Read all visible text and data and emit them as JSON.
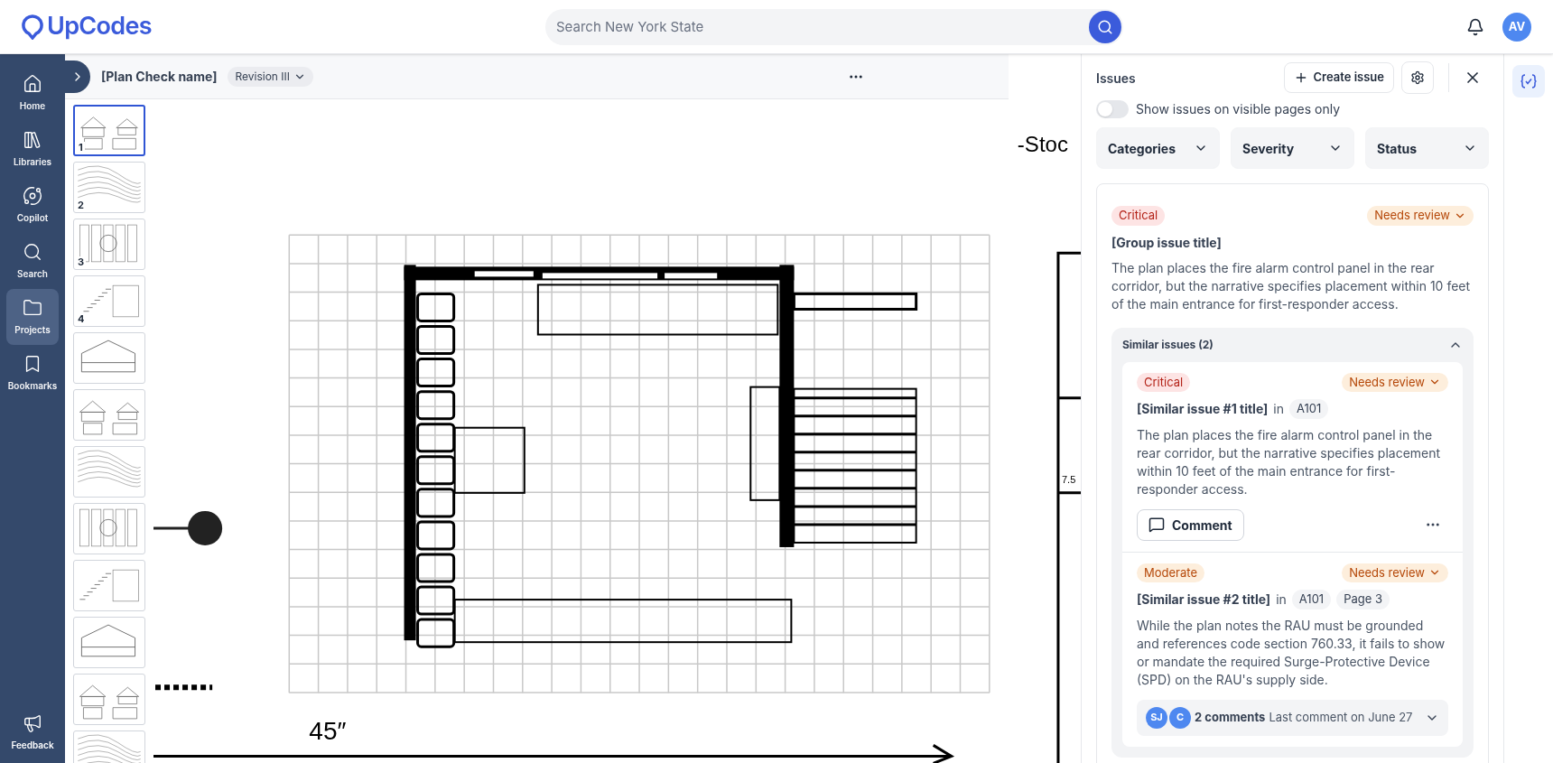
{
  "brand": {
    "name": "UpCodes"
  },
  "search": {
    "placeholder": "Search New York State"
  },
  "user": {
    "initials": "AV"
  },
  "nav": [
    {
      "kind": "home",
      "label": "Home",
      "selected": false
    },
    {
      "kind": "libraries",
      "label": "Libraries",
      "selected": false
    },
    {
      "kind": "copilot",
      "label": "Copilot",
      "selected": false
    },
    {
      "kind": "search",
      "label": "Search",
      "selected": false
    },
    {
      "kind": "projects",
      "label": "Projects",
      "selected": true
    },
    {
      "kind": "bookmarks",
      "label": "Bookmarks",
      "selected": false
    }
  ],
  "nav_footer": {
    "label": "Feedback"
  },
  "viewer": {
    "title": "[Plan Check name]",
    "revision": "Revision III"
  },
  "thumbnails": [
    {
      "label": "1",
      "selected": true
    },
    {
      "label": "2",
      "selected": false
    },
    {
      "label": "3",
      "selected": false
    },
    {
      "label": "4",
      "selected": false
    },
    {
      "selected": false
    },
    {
      "selected": false
    },
    {
      "selected": false
    },
    {
      "selected": false
    },
    {
      "selected": false
    },
    {
      "selected": false
    },
    {
      "selected": false
    },
    {
      "selected": false
    }
  ],
  "plan": {
    "labels": [
      "-Stoc",
      "45″",
      "7.5"
    ]
  },
  "issues": {
    "title": "Issues",
    "create_label": "Create issue",
    "toggle": {
      "label": "Show issues on visible pages only",
      "on": false
    },
    "filters": [
      "Categories",
      "Severity",
      "Status"
    ],
    "group": {
      "severity": {
        "kind": "critical",
        "label": "Critical"
      },
      "status": "Needs review",
      "title": "[Group issue title]",
      "body": "The plan places the fire alarm control panel in the rear corridor, but the narrative specifies placement within 10 feet of the main entrance for first-responder access.",
      "similar": {
        "label": "Similar issues (2)",
        "expanded": true,
        "items": [
          {
            "severity": {
              "kind": "critical",
              "label": "Critical"
            },
            "status": "Needs review",
            "title": "[Similar issue #1 title]",
            "in": "in",
            "tags": [
              "A101"
            ],
            "body": "The plan places the fire alarm control panel in the rear corridor, but the narrative specifies placement within 10 feet of the main entrance for first-responder access.",
            "footer": {
              "kind": "comment",
              "label": "Comment"
            }
          },
          {
            "severity": {
              "kind": "moderate",
              "label": "Moderate"
            },
            "status": "Needs review",
            "title": "[Similar issue #2 title]",
            "in": "in",
            "tags": [
              "A101",
              "Page 3"
            ],
            "body": "While the plan notes the RAU must be grounded and references code section 760.33, it fails to show or mandate the required Surge-Protective Device (SPD) on the RAU's supply side.",
            "footer": {
              "kind": "thread",
              "avatars": [
                "SJ",
                "C"
              ],
              "count": "2 comments",
              "last": "Last comment on June 27"
            }
          }
        ]
      }
    }
  }
}
